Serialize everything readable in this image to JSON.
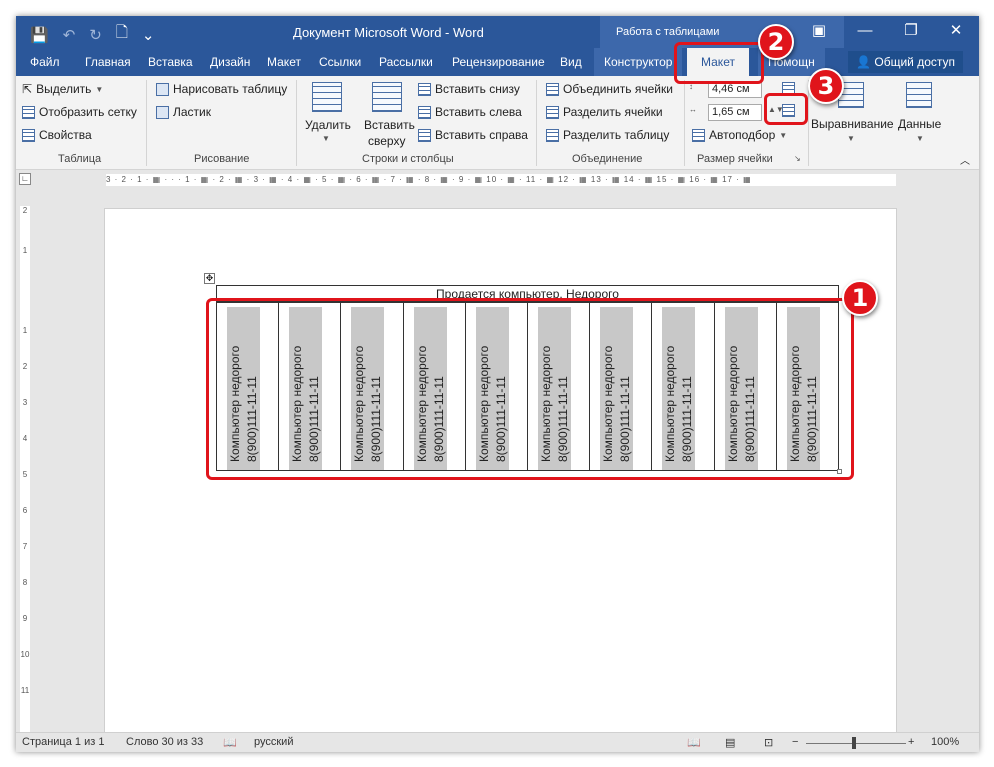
{
  "window": {
    "title": "Документ Microsoft Word - Word",
    "context_title": "Работа с таблицами",
    "minimize": "—",
    "restore": "❐",
    "close": "✕",
    "ribbon_options": "▣"
  },
  "qat": {
    "save": "💾",
    "undo": "↶",
    "redo": "↻",
    "new": "🗋",
    "more": "⌄"
  },
  "tabs": {
    "file": "Файл",
    "home": "Главная",
    "insert": "Вставка",
    "design": "Дизайн",
    "layout": "Макет",
    "references": "Ссылки",
    "mailings": "Рассылки",
    "review": "Рецензирование",
    "view": "Вид",
    "table_design": "Конструктор",
    "table_layout": "Макет",
    "help": "Помощн",
    "share": "Общий доступ"
  },
  "ribbon": {
    "table": {
      "select": "Выделить",
      "gridlines": "Отобразить сетку",
      "properties": "Свойства",
      "label": "Таблица"
    },
    "draw": {
      "draw_table": "Нарисовать таблицу",
      "eraser": "Ластик",
      "label": "Рисование"
    },
    "rows_cols": {
      "delete": "Удалить",
      "insert_above_1": "Вставить",
      "insert_above_2": "сверху",
      "insert_below": "Вставить снизу",
      "insert_left": "Вставить слева",
      "insert_right": "Вставить справа",
      "label": "Строки и столбцы"
    },
    "merge": {
      "merge_cells": "Объединить ячейки",
      "split_cells": "Разделить ячейки",
      "split_table": "Разделить таблицу",
      "label": "Объединение"
    },
    "cell_size": {
      "height": "4,46 см",
      "width": "1,65 см",
      "autofit": "Автоподбор",
      "label": "Размер ячейки"
    },
    "alignment": "Выравнивание",
    "data": "Данные"
  },
  "ruler": {
    "h": "3 · 2 · 1 · ▦ · · · 1 · ▦ · 2 · ▦ · 3 · ▦ · 4 · ▦ · 5 · ▦ · 6 · ▦ · 7 · ▦ · 8 · ▦ · 9 · ▦ 10 · ▦ · 11 · ▦ 12 · ▦ 13 · ▦ 14 · ▦ 15 · ▦ 16 · ▦ 17 · ▦",
    "v": [
      "2",
      "1",
      "1",
      "2",
      "3",
      "4",
      "5",
      "6",
      "7",
      "8",
      "9",
      "10",
      "11"
    ],
    "corner": "∟"
  },
  "document": {
    "header_text": "Продается компьютер. Недорого",
    "cells": [
      {
        "line1": "Компьютер недорого",
        "line2": "8(900)111-11-11"
      },
      {
        "line1": "Компьютер недорого",
        "line2": "8(900)111-11-11"
      },
      {
        "line1": "Компьютер недорого",
        "line2": "8(900)111-11-11"
      },
      {
        "line1": "Компьютер недорого",
        "line2": "8(900)111-11-11"
      },
      {
        "line1": "Компьютер недорого",
        "line2": "8(900)111-11-11"
      },
      {
        "line1": "Компьютер недорого",
        "line2": "8(900)111-11-11"
      },
      {
        "line1": "Компьютер недорого",
        "line2": "8(900)111-11-11"
      },
      {
        "line1": "Компьютер недорого",
        "line2": "8(900)111-11-11"
      },
      {
        "line1": "Компьютер недорого",
        "line2": "8(900)111-11-11"
      },
      {
        "line1": "Компьютер недорого",
        "line2": "8(900)111-11-11"
      }
    ]
  },
  "status": {
    "page": "Страница 1 из 1",
    "words": "Слово 30 из 33",
    "language": "русский",
    "zoom": "100%",
    "zoom_minus": "−",
    "zoom_plus": "+"
  },
  "annotations": {
    "b1": "1",
    "b2": "2",
    "b3": "3",
    "color": "#e0141b"
  },
  "colors": {
    "accent": "#2b579a",
    "context_tab": "#3d68ab",
    "ribbon_bg": "#f3f3f3",
    "cell_shade": "#c8c8c8"
  }
}
